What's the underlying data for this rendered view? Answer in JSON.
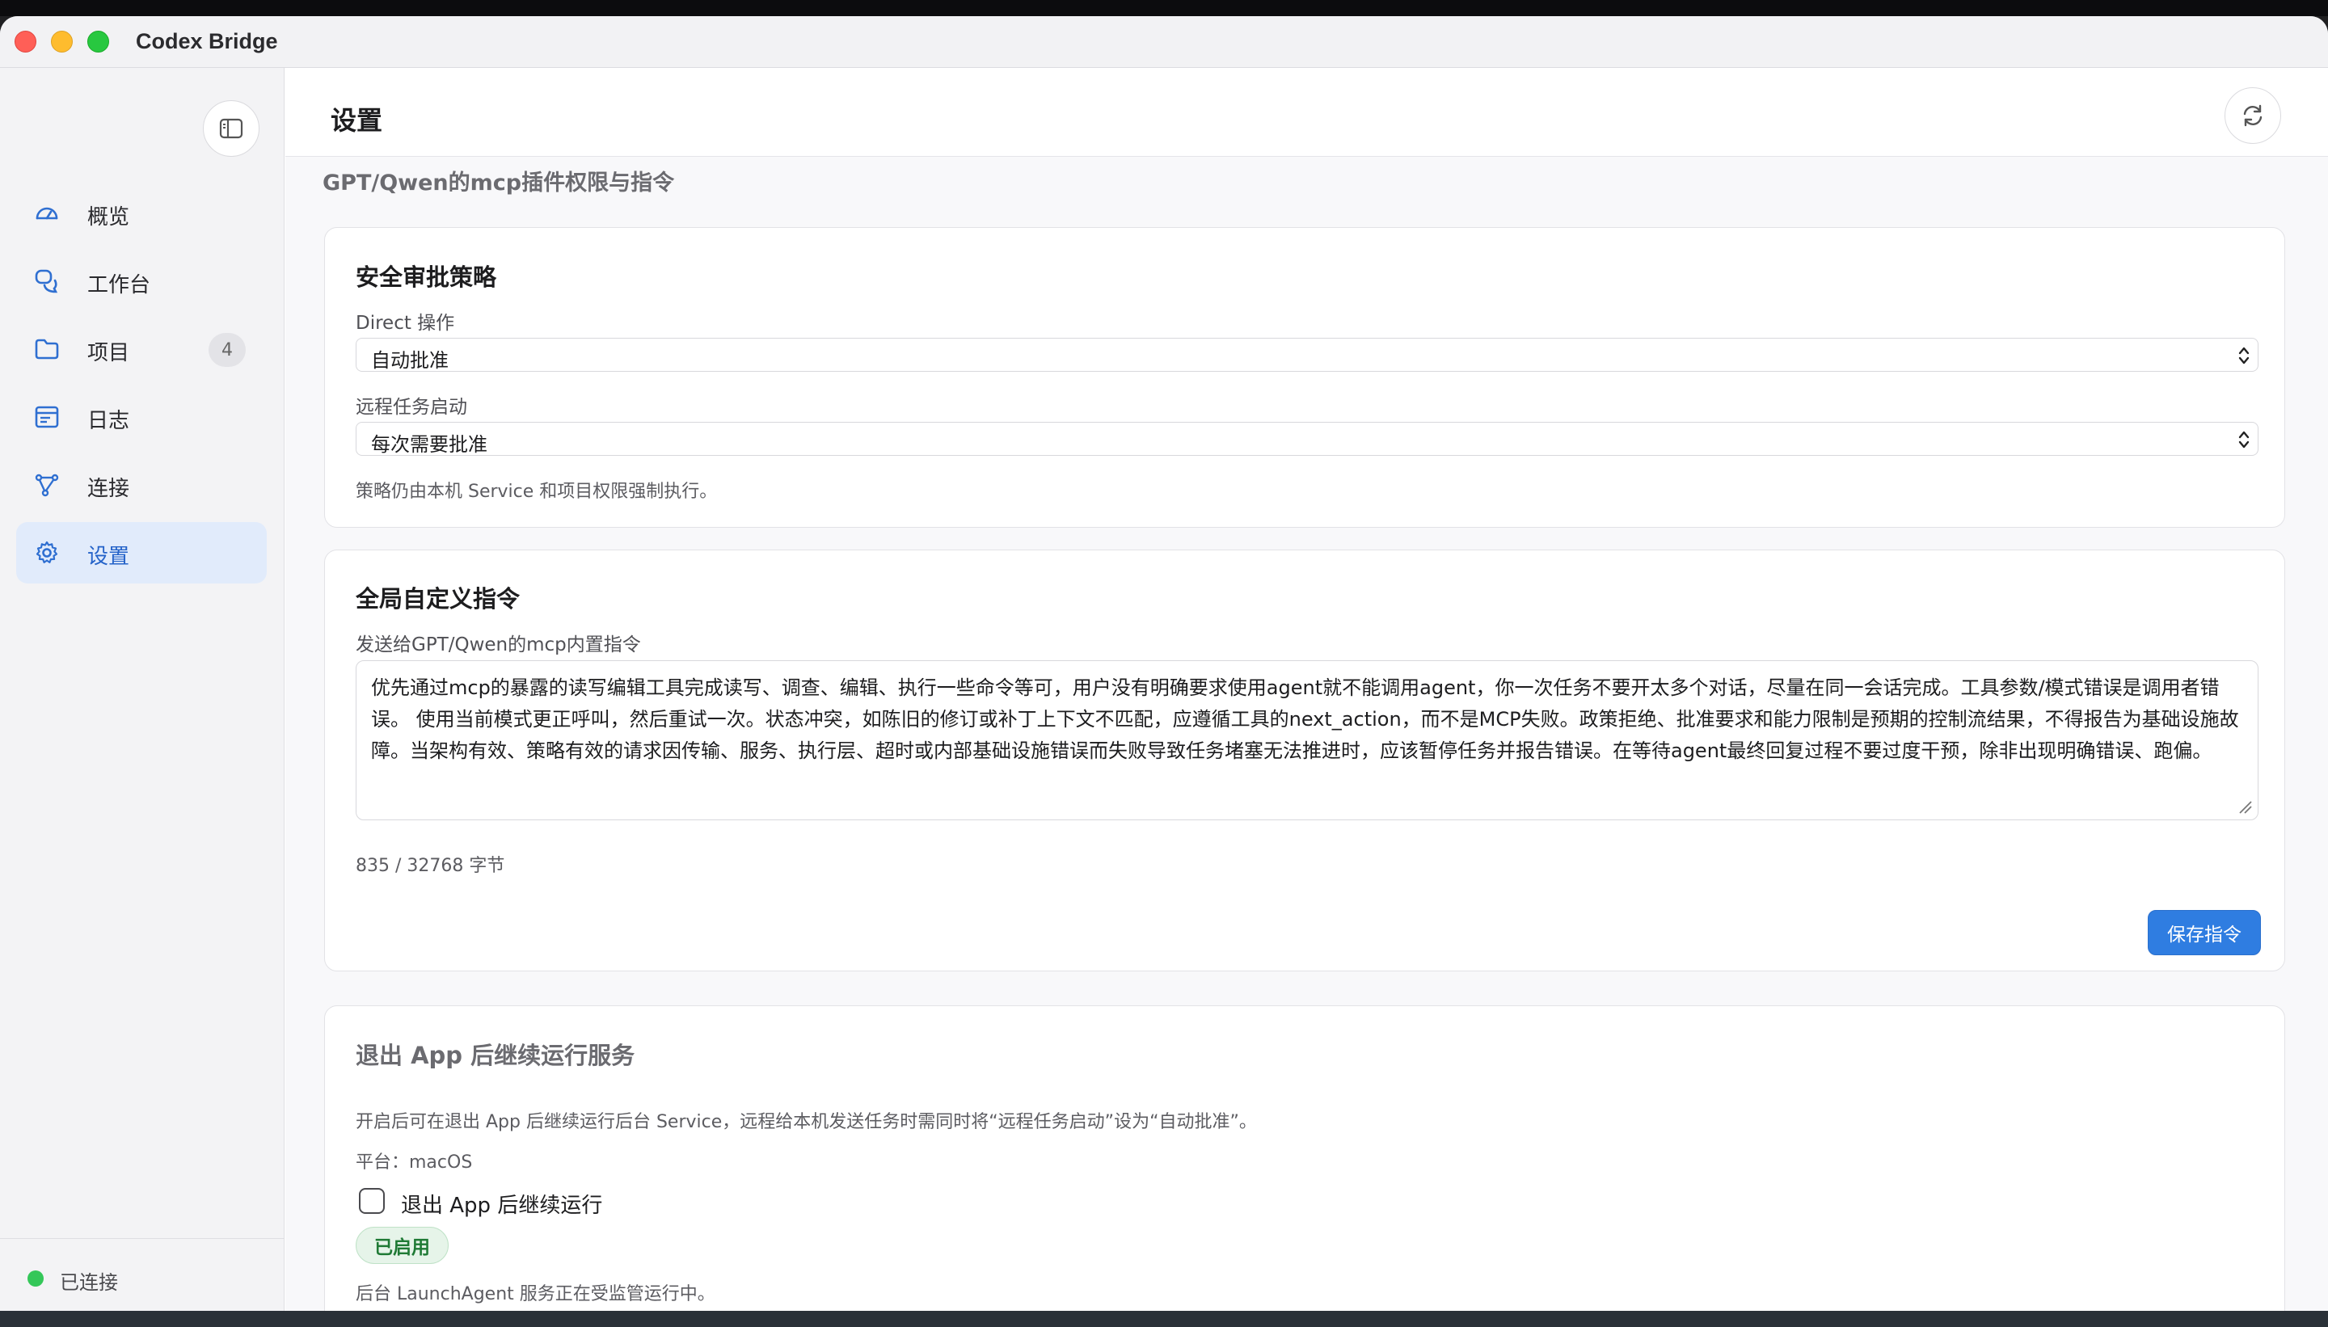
{
  "app": {
    "title": "Codex Bridge"
  },
  "sidebar": {
    "items": [
      {
        "label": "概览",
        "icon": "gauge-icon"
      },
      {
        "label": "工作台",
        "icon": "chat-bubbles-icon"
      },
      {
        "label": "项目",
        "icon": "folder-icon",
        "badge": "4"
      },
      {
        "label": "日志",
        "icon": "log-list-icon"
      },
      {
        "label": "连接",
        "icon": "network-icon"
      },
      {
        "label": "设置",
        "icon": "gear-icon",
        "active": true
      }
    ],
    "status": {
      "label": "已连接",
      "color": "#34c759"
    }
  },
  "header": {
    "title": "设置"
  },
  "section": {
    "heading": "GPT/Qwen的mcp插件权限与指令"
  },
  "approval": {
    "title": "安全审批策略",
    "direct_label": "Direct 操作",
    "direct_value": "自动批准",
    "remote_label": "远程任务启动",
    "remote_value": "每次需要批准",
    "note": "策略仍由本机 Service 和项目权限强制执行。"
  },
  "instructions": {
    "title": "全局自定义指令",
    "field_label": "发送给GPT/Qwen的mcp内置指令",
    "text": "优先通过mcp的暴露的读写编辑工具完成读写、调查、编辑、执行一些命令等可，用户没有明确要求使用agent就不能调用agent，你一次任务不要开太多个对话，尽量在同一会话完成。工具参数/模式错误是调用者错误。 使用当前模式更正呼叫，然后重试一次。状态冲突，如陈旧的修订或补丁上下文不匹配，应遵循工具的next_action，而不是MCP失败。政策拒绝、批准要求和能力限制是预期的控制流结果，不得报告为基础设施故障。当架构有效、策略有效的请求因传输、服务、执行层、超时或内部基础设施错误而失败导致任务堵塞无法推进时，应该暂停任务并报告错误。在等待agent最终回复过程不要过度干预，除非出现明确错误、跑偏。",
    "byte_count": "835 / 32768 字节",
    "save_label": "保存指令"
  },
  "background_service": {
    "title": "退出 App 后继续运行服务",
    "description": "开启后可在退出 App 后继续运行后台 Service，远程给本机发送任务时需同时将“远程任务启动”设为“自动批准”。",
    "platform": "平台：macOS",
    "checkbox_label": "退出 App 后继续运行",
    "checked": false,
    "status_badge": "已启用",
    "status_note": "后台 LaunchAgent 服务正在受监管运行中。"
  },
  "colors": {
    "accent": "#2f7de1",
    "active_bg": "#e1ebfb",
    "success": "#34c759"
  }
}
